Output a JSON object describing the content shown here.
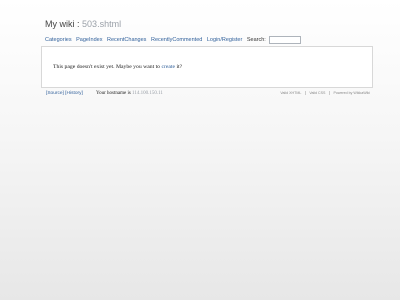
{
  "header": {
    "site_title": "My wiki",
    "separator": ":",
    "page_name": "503.shtml"
  },
  "nav": {
    "items": [
      "Categories",
      "PageIndex",
      "RecentChanges",
      "RecentlyCommented",
      "Login/Register"
    ],
    "search_label": "Search:",
    "search_value": ""
  },
  "content": {
    "message_prefix": "This page doesn't exist yet. Maybe you want to",
    "create_link": "create",
    "message_suffix": "it?"
  },
  "footer": {
    "source_link": "[Source]",
    "history_link": "[History]",
    "host_label": "Your hostname is",
    "host_ip": "114.100.150.11",
    "badges": [
      "Valid XHTML",
      "Valid CSS",
      "Powered by WikkaWiki"
    ]
  }
}
